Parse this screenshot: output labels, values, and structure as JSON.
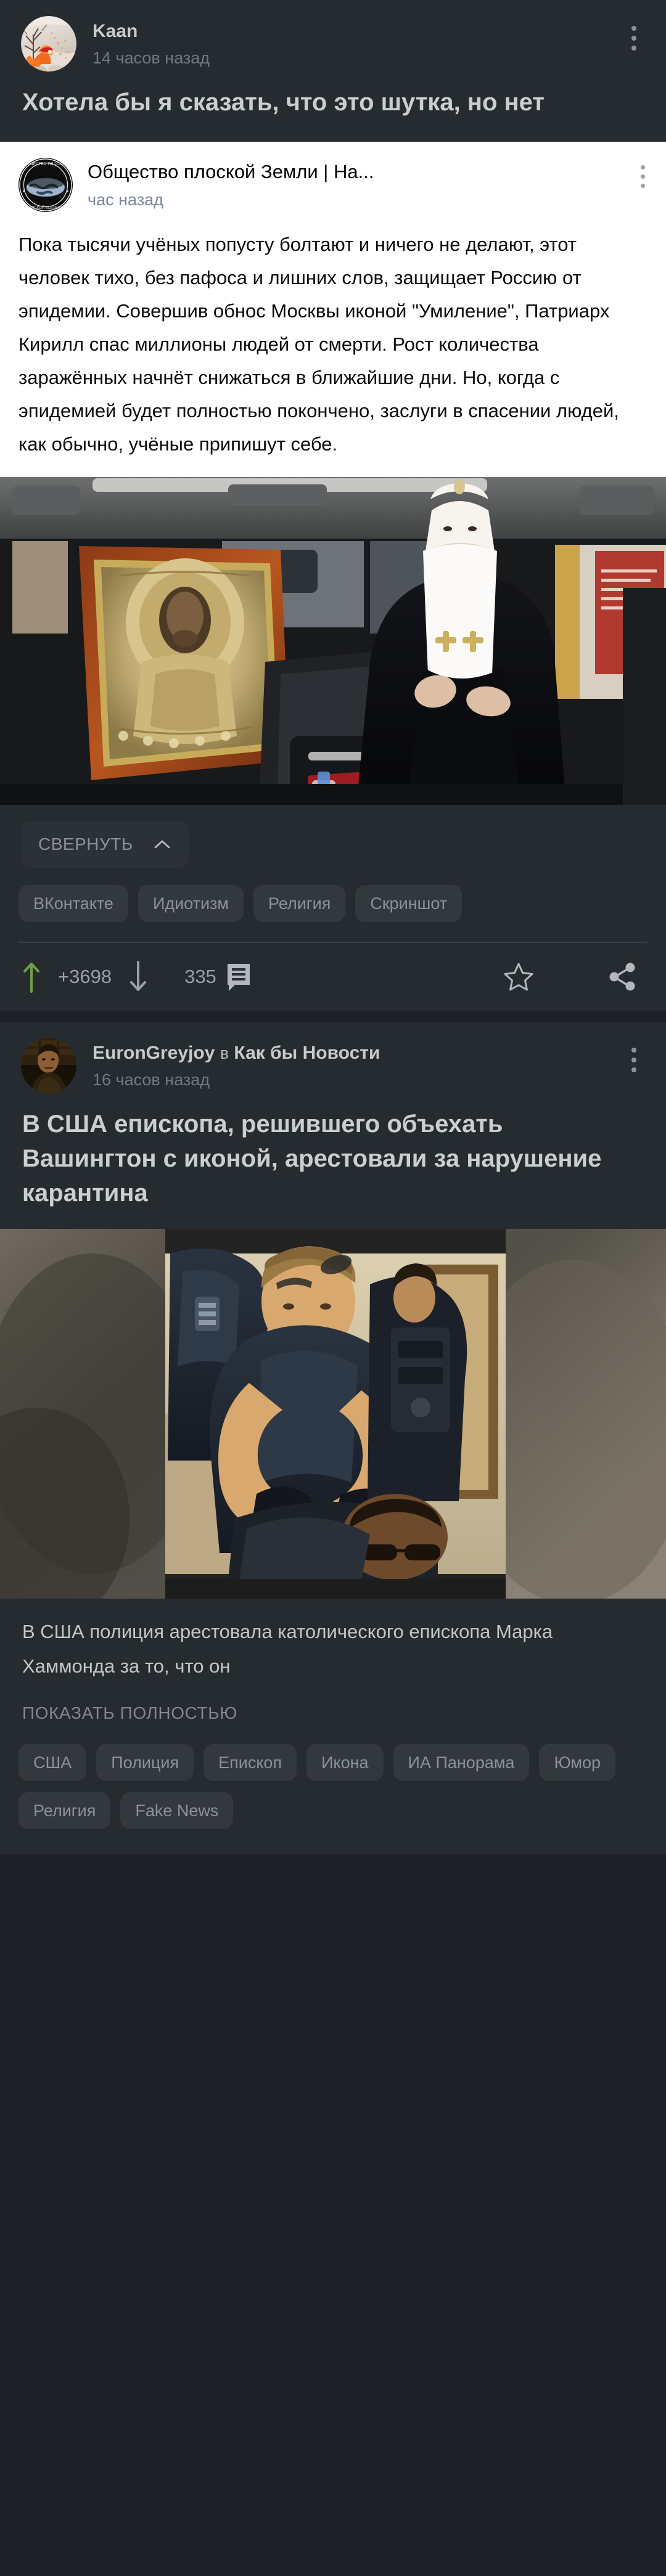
{
  "app": {
    "background_color": "#1d2125",
    "card_color": "#262b2f",
    "accent_upvote_color": "#6f9e49",
    "text_primary": "#c9ced1",
    "text_secondary": "#72797e",
    "tag_background": "#33383d"
  },
  "posts": [
    {
      "author": "Kaan",
      "timestamp": "14 часов назад",
      "title": "Хотела бы я сказать, что это шутка, но нет",
      "avatar_icon": "fox-winter-avatar",
      "menu_icon": "kebab-menu-icon"
    },
    {
      "embedded_screenshot": {
        "community": "Общество плоской Земли | На...",
        "timestamp": "час назад",
        "avatar_icon": "flat-earth-society-emblem",
        "menu_icon": "kebab-menu-icon",
        "body": "Пока тысячи учёных попусту болтают и ничего не делают, этот человек тихо, без пафоса и лишних слов, защищает Россию от эпидемии. Совершив обнос Москвы иконой \"Умиление\", Патриарх Кирилл спас миллионы людей от смерти. Рост количества заражённых начнёт снижаться в ближайшие дни. Но, когда с эпидемией будет полностью покончено, заслуги в спасении людей, как обычно, учёные припишут себе.",
        "photo_alt": "patriarch-in-car-with-icon"
      },
      "collapse_label": "СВЕРНУТЬ",
      "collapse_icon": "chevron-up-icon",
      "tags": [
        "ВКонтакте",
        "Идиотизм",
        "Религия",
        "Скриншот"
      ],
      "actions": {
        "upvote_icon": "arrow-up-icon",
        "score": "+3698",
        "downvote_icon": "arrow-down-icon",
        "comments_count": "335",
        "comments_icon": "comment-icon",
        "favorite_icon": "star-icon",
        "share_icon": "share-icon"
      }
    },
    {
      "author": "EuronGreyjoy",
      "in_word": "в",
      "community": "Как бы Новости",
      "timestamp": "16 часов назад",
      "avatar_icon": "man-portrait-avatar",
      "menu_icon": "kebab-menu-icon",
      "title": "В США епископа, решившего объехать Вашингтон с иконой, арестовали за нарушение карантина",
      "photo_alt": "police-arresting-man-on-floor",
      "caption": "В США полиция арестовала католического епископа Марка Хаммонда за то, что он",
      "show_more_label": "ПОКАЗАТЬ ПОЛНОСТЬЮ",
      "tags": [
        "США",
        "Полиция",
        "Епископ",
        "Икона",
        "ИА Панорама",
        "Юмор",
        "Религия",
        "Fake News"
      ]
    }
  ]
}
